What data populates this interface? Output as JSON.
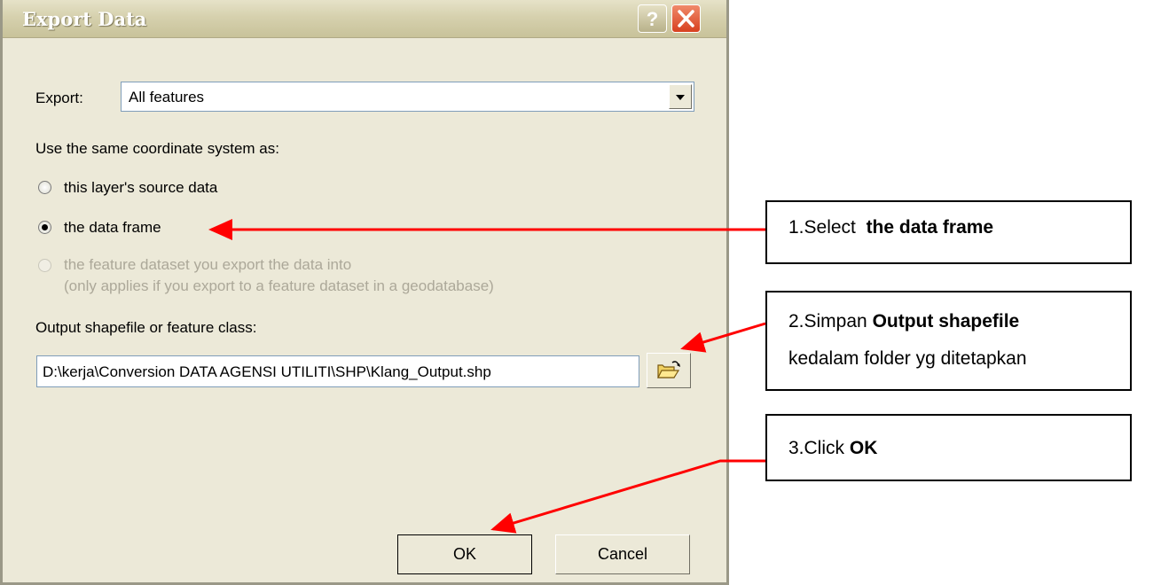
{
  "dialog": {
    "title": "Export Data",
    "export_label": "Export:",
    "export_value": "All features",
    "coord_heading": "Use the same coordinate system as:",
    "radios": [
      {
        "label": "this layer's source data",
        "checked": false,
        "disabled": false
      },
      {
        "label": "the data frame",
        "checked": true,
        "disabled": false
      },
      {
        "label": "the feature dataset you export the data into",
        "label2": "(only applies if you export to a feature dataset in a geodatabase)",
        "checked": false,
        "disabled": true
      }
    ],
    "output_label": "Output shapefile or feature class:",
    "output_path": "D:\\kerja\\Conversion DATA AGENSI UTILITI\\SHP\\Klang_Output.shp",
    "ok_label": "OK",
    "cancel_label": "Cancel"
  },
  "callouts": {
    "step1_prefix": "1.Select  ",
    "step1_bold": "the data frame",
    "step2_prefix": "2.Simpan ",
    "step2_bold": "Output shapefile",
    "step2_line2": "kedalam folder yg ditetapkan",
    "step3_prefix": "3.Click ",
    "step3_bold": "OK"
  },
  "colors": {
    "arrow": "#ff0000",
    "dialog_bg": "#ece9d8",
    "disabled_text": "#aca899"
  }
}
